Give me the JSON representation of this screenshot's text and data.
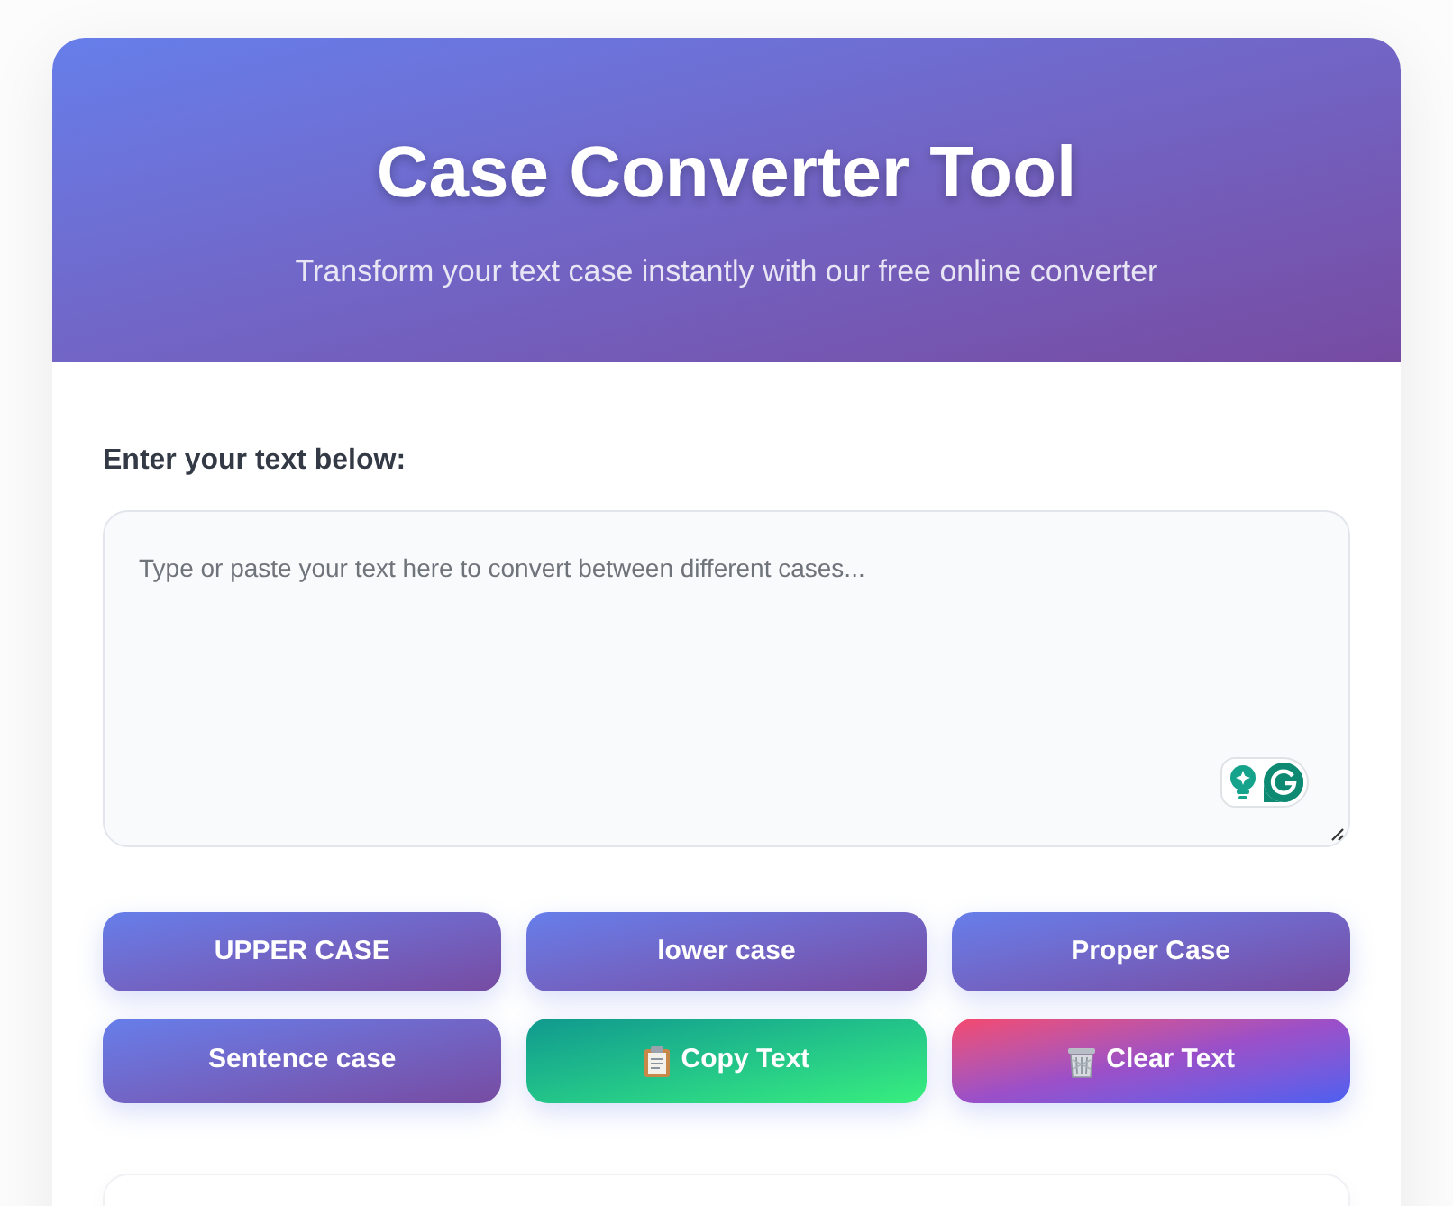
{
  "header": {
    "title": "Case Converter Tool",
    "subtitle": "Transform your text case instantly with our free online converter"
  },
  "input": {
    "label": "Enter your text below:",
    "placeholder": "Type or paste your text here to convert between different cases..."
  },
  "buttons": [
    {
      "label": "UPPER CASE",
      "kind": "case"
    },
    {
      "label": "lower case",
      "kind": "case"
    },
    {
      "label": "Proper Case",
      "kind": "case"
    },
    {
      "label": "Sentence case",
      "kind": "case"
    },
    {
      "label": "Copy Text",
      "kind": "copy"
    },
    {
      "label": "Clear Text",
      "kind": "clear"
    }
  ]
}
